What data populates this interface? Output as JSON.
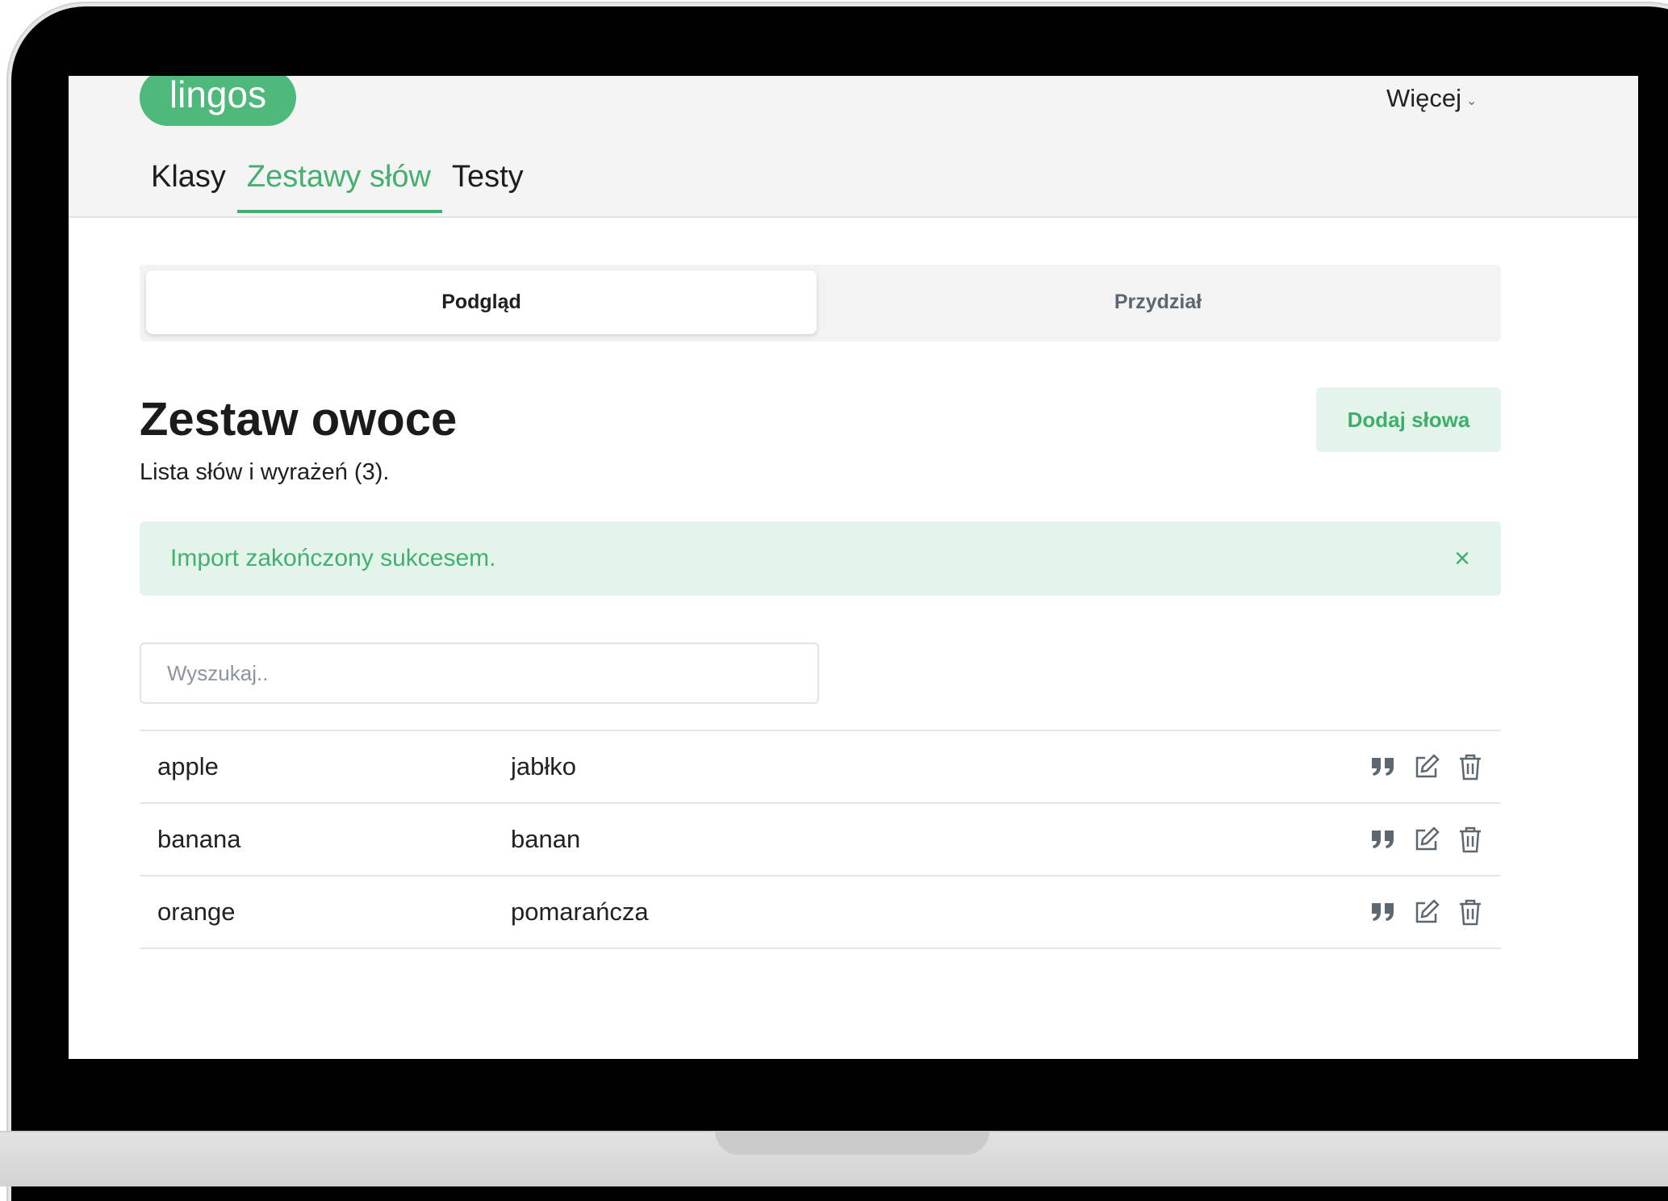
{
  "app": {
    "logo": "lingos",
    "more_menu": "Więcej"
  },
  "nav": {
    "tabs": [
      {
        "label": "Klasy",
        "active": false
      },
      {
        "label": "Zestawy słów",
        "active": true
      },
      {
        "label": "Testy",
        "active": false
      }
    ]
  },
  "segmented": {
    "active": "Podgląd",
    "inactive": "Przydział"
  },
  "page": {
    "title": "Zestaw owoce",
    "subtitle": "Lista słów i wyrażeń (3).",
    "add_button": "Dodaj słowa"
  },
  "alert": {
    "text": "Import zakończony sukcesem.",
    "close": "×"
  },
  "search": {
    "placeholder": "Wyszukaj..",
    "value": ""
  },
  "words": [
    {
      "source": "apple",
      "translation": "jabłko"
    },
    {
      "source": "banana",
      "translation": "banan"
    },
    {
      "source": "orange",
      "translation": "pomarańcza"
    }
  ],
  "colors": {
    "accent": "#45ae70",
    "accent_light": "#e3f5ea",
    "icon": "#5d6770"
  },
  "icons": {
    "row_actions": [
      "quote-icon",
      "edit-icon",
      "trash-icon"
    ]
  }
}
